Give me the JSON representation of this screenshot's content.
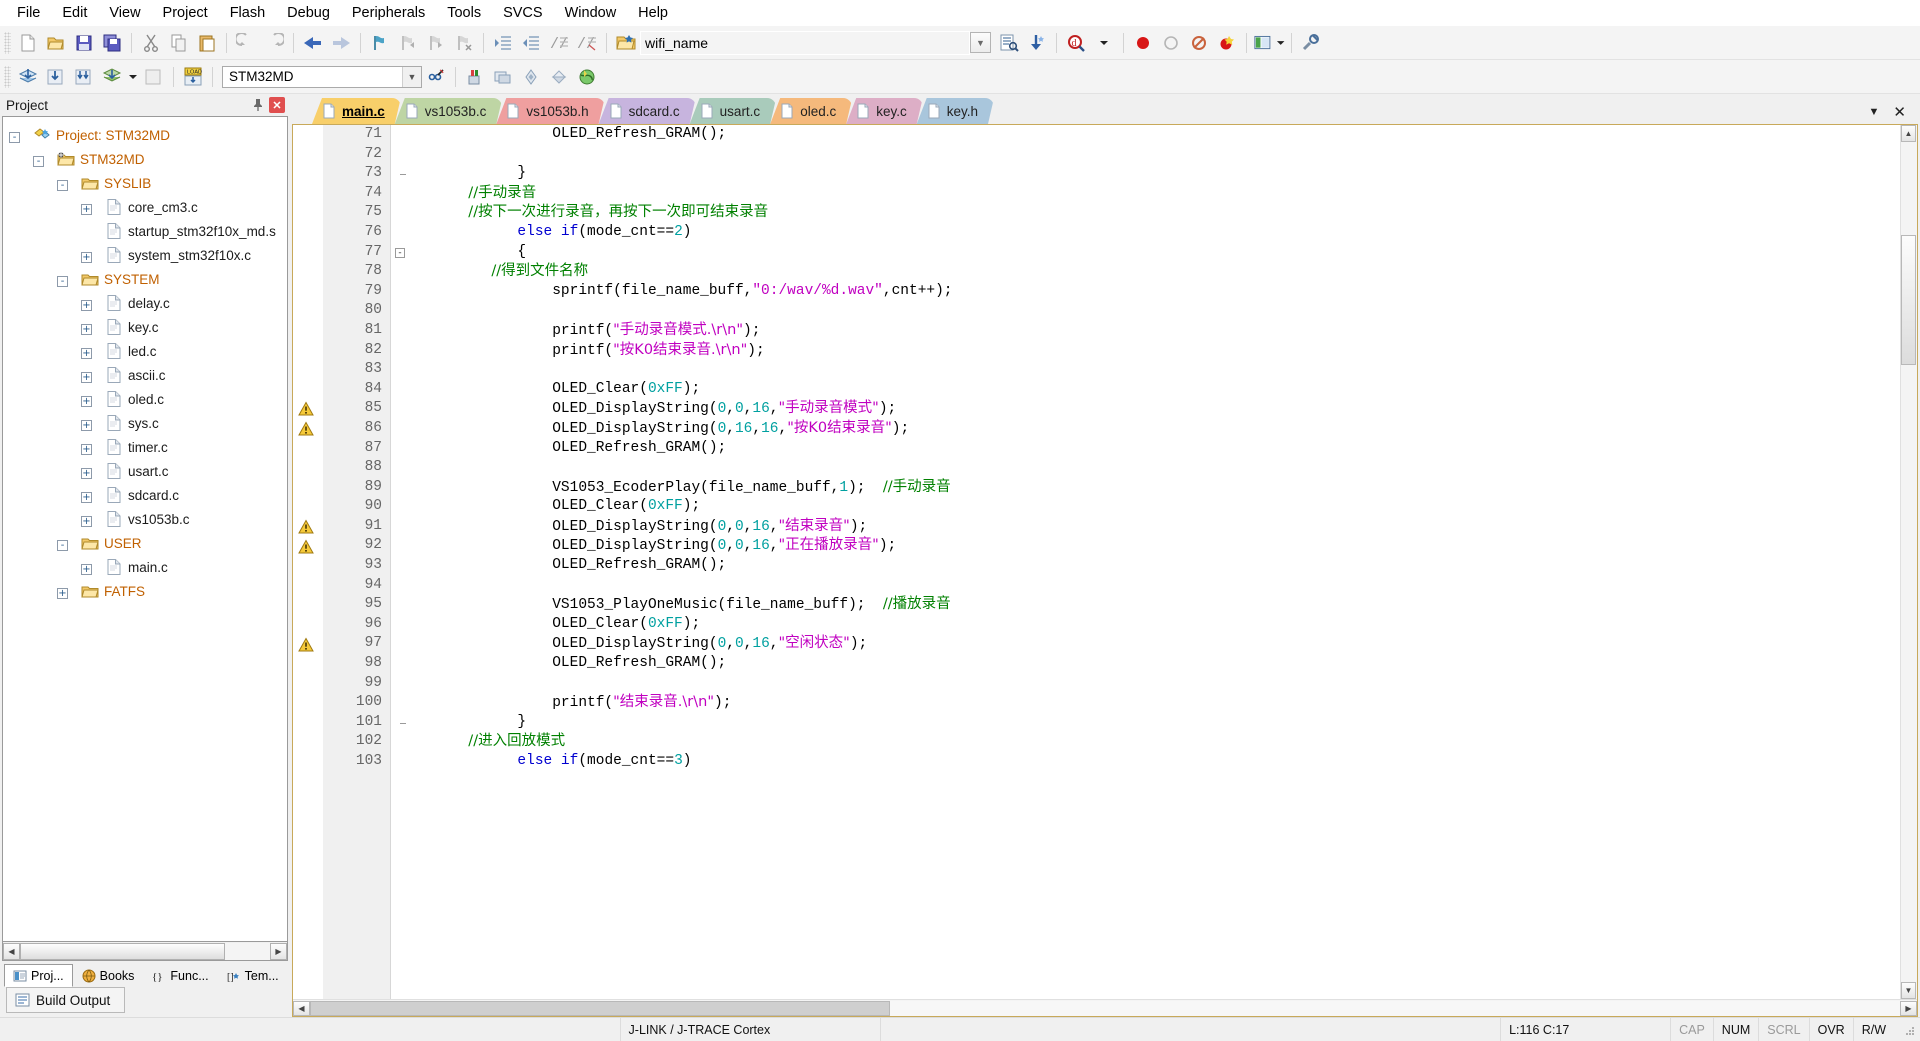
{
  "menu": {
    "items": [
      "File",
      "Edit",
      "View",
      "Project",
      "Flash",
      "Debug",
      "Peripherals",
      "Tools",
      "SVCS",
      "Window",
      "Help"
    ]
  },
  "toolbar1": {
    "icons": [
      "new-file-icon",
      "open-file-icon",
      "save-icon",
      "save-all-icon",
      "cut-icon",
      "copy-icon",
      "paste-icon",
      "undo-icon",
      "redo-icon",
      "navigate-back-icon",
      "navigate-forward-icon",
      "bookmark-toggle-icon",
      "bookmark-prev-icon",
      "bookmark-next-icon",
      "bookmark-clear-icon",
      "indent-icon",
      "outdent-icon",
      "comment-icon",
      "uncomment-icon"
    ],
    "bookmark_field": "wifi_name",
    "bookmark_placeholder": "",
    "right_icons": [
      "find-in-files-icon",
      "incremental-find-icon",
      "magnifier-icon",
      "dropdown-arrow-icon",
      "start-debug-icon",
      "insert-breakpoint-icon",
      "kill-breakpoints-icon",
      "disable-breakpoints-icon",
      "window-layout-icon",
      "configuration-wizard-icon"
    ]
  },
  "toolbar2": {
    "target": "STM32MD",
    "icons": [
      "translate-icon",
      "build-icon",
      "rebuild-icon",
      "batch-build-icon",
      "stop-build-icon",
      "download-icon",
      "target-options-icon",
      "manage-project-items-icon",
      "start-stop-debug-icon",
      "multi-project-icon",
      "books-icon",
      "functions-icon",
      "templates-icon"
    ]
  },
  "project_panel": {
    "title": "Project",
    "pin_icon": "pin-icon",
    "close_icon": "close-icon",
    "tree": [
      {
        "depth": 0,
        "label": "Project: STM32MD",
        "expander": "-",
        "icon": "project-icon",
        "kind": "root"
      },
      {
        "depth": 1,
        "label": "STM32MD",
        "expander": "-",
        "icon": "target-folder-icon",
        "kind": "folder"
      },
      {
        "depth": 2,
        "label": "SYSLIB",
        "expander": "-",
        "icon": "group-folder-icon",
        "kind": "folder"
      },
      {
        "depth": 3,
        "label": "core_cm3.c",
        "expander": "+",
        "icon": "c-file-icon",
        "kind": "file"
      },
      {
        "depth": 3,
        "label": "startup_stm32f10x_md.s",
        "expander": "",
        "icon": "asm-file-icon",
        "kind": "file"
      },
      {
        "depth": 3,
        "label": "system_stm32f10x.c",
        "expander": "+",
        "icon": "c-file-icon",
        "kind": "file"
      },
      {
        "depth": 2,
        "label": "SYSTEM",
        "expander": "-",
        "icon": "group-folder-icon",
        "kind": "folder"
      },
      {
        "depth": 3,
        "label": "delay.c",
        "expander": "+",
        "icon": "c-file-icon",
        "kind": "file"
      },
      {
        "depth": 3,
        "label": "key.c",
        "expander": "+",
        "icon": "c-file-icon",
        "kind": "file"
      },
      {
        "depth": 3,
        "label": "led.c",
        "expander": "+",
        "icon": "c-file-icon",
        "kind": "file"
      },
      {
        "depth": 3,
        "label": "ascii.c",
        "expander": "+",
        "icon": "c-file-icon",
        "kind": "file"
      },
      {
        "depth": 3,
        "label": "oled.c",
        "expander": "+",
        "icon": "c-file-icon",
        "kind": "file"
      },
      {
        "depth": 3,
        "label": "sys.c",
        "expander": "+",
        "icon": "c-file-icon",
        "kind": "file"
      },
      {
        "depth": 3,
        "label": "timer.c",
        "expander": "+",
        "icon": "c-file-icon",
        "kind": "file"
      },
      {
        "depth": 3,
        "label": "usart.c",
        "expander": "+",
        "icon": "c-file-icon",
        "kind": "file"
      },
      {
        "depth": 3,
        "label": "sdcard.c",
        "expander": "+",
        "icon": "c-file-icon",
        "kind": "file"
      },
      {
        "depth": 3,
        "label": "vs1053b.c",
        "expander": "+",
        "icon": "c-file-icon",
        "kind": "file"
      },
      {
        "depth": 2,
        "label": "USER",
        "expander": "-",
        "icon": "group-folder-icon",
        "kind": "folder"
      },
      {
        "depth": 3,
        "label": "main.c",
        "expander": "+",
        "icon": "c-file-icon",
        "kind": "file"
      },
      {
        "depth": 2,
        "label": "FATFS",
        "expander": "+",
        "icon": "group-folder-icon",
        "kind": "folder"
      }
    ],
    "bottom_tabs": [
      {
        "label": "Proj...",
        "icon": "project-tab-icon",
        "active": true
      },
      {
        "label": "Books",
        "icon": "books-tab-icon",
        "active": false
      },
      {
        "label": "Func...",
        "icon": "functions-tab-icon",
        "active": false
      },
      {
        "label": "Tem...",
        "icon": "templates-tab-icon",
        "active": false
      }
    ],
    "build_output_label": "Build Output",
    "build_output_icon": "build-output-icon"
  },
  "editor": {
    "tabs": [
      {
        "label": "main.c",
        "color": "#f8cf6a",
        "active": true
      },
      {
        "label": "vs1053b.c",
        "color": "#bed5a4",
        "active": false
      },
      {
        "label": "vs1053b.h",
        "color": "#ef9f9f",
        "active": false
      },
      {
        "label": "sdcard.c",
        "color": "#c7b4de",
        "active": false
      },
      {
        "label": "usart.c",
        "color": "#a9cbbb",
        "active": false
      },
      {
        "label": "oled.c",
        "color": "#f5b97c",
        "active": false
      },
      {
        "label": "key.c",
        "color": "#ddaec6",
        "active": false
      },
      {
        "label": "key.h",
        "color": "#a9c6dc",
        "active": false
      }
    ],
    "tabbar_caret_icon": "chevron-down-icon",
    "tabbar_close_icon": "close-icon",
    "first_line": 71,
    "lines": [
      {
        "n": 71,
        "warn": false,
        "fold": "",
        "tokens": [
          {
            "t": "                ",
            "c": "plain"
          },
          {
            "t": "OLED_Refresh_GRAM();",
            "c": "plain"
          }
        ]
      },
      {
        "n": 72,
        "warn": false,
        "fold": "",
        "tokens": []
      },
      {
        "n": 73,
        "warn": false,
        "fold": "tick",
        "tokens": [
          {
            "t": "            }",
            "c": "plain"
          }
        ]
      },
      {
        "n": 74,
        "warn": false,
        "fold": "",
        "tokens": [
          {
            "t": "            //手动录音",
            "c": "cmt"
          }
        ]
      },
      {
        "n": 75,
        "warn": false,
        "fold": "",
        "tokens": [
          {
            "t": "            //按下一次进行录音，再按下一次即可结束录音",
            "c": "cmt"
          }
        ]
      },
      {
        "n": 76,
        "warn": false,
        "fold": "",
        "tokens": [
          {
            "t": "            ",
            "c": "plain"
          },
          {
            "t": "else if",
            "c": "kw"
          },
          {
            "t": "(mode_cnt==",
            "c": "plain"
          },
          {
            "t": "2",
            "c": "num"
          },
          {
            "t": ")",
            "c": "plain"
          }
        ]
      },
      {
        "n": 77,
        "warn": false,
        "fold": "box",
        "tokens": [
          {
            "t": "            {",
            "c": "plain"
          }
        ]
      },
      {
        "n": 78,
        "warn": false,
        "fold": "",
        "tokens": [
          {
            "t": "                 //得到文件名称",
            "c": "cmt"
          }
        ]
      },
      {
        "n": 79,
        "warn": false,
        "fold": "",
        "tokens": [
          {
            "t": "                sprintf(file_name_buff,",
            "c": "plain"
          },
          {
            "t": "\"0:/wav/%d.wav\"",
            "c": "str"
          },
          {
            "t": ",cnt++);",
            "c": "plain"
          }
        ]
      },
      {
        "n": 80,
        "warn": false,
        "fold": "",
        "tokens": []
      },
      {
        "n": 81,
        "warn": false,
        "fold": "",
        "tokens": [
          {
            "t": "                printf(",
            "c": "plain"
          },
          {
            "t": "\"手动录音模式.\\r\\n\"",
            "c": "str"
          },
          {
            "t": ");",
            "c": "plain"
          }
        ]
      },
      {
        "n": 82,
        "warn": false,
        "fold": "",
        "tokens": [
          {
            "t": "                printf(",
            "c": "plain"
          },
          {
            "t": "\"按K0结束录音.\\r\\n\"",
            "c": "str"
          },
          {
            "t": ");",
            "c": "plain"
          }
        ]
      },
      {
        "n": 83,
        "warn": false,
        "fold": "",
        "tokens": []
      },
      {
        "n": 84,
        "warn": false,
        "fold": "",
        "tokens": [
          {
            "t": "                OLED_Clear(",
            "c": "plain"
          },
          {
            "t": "0xFF",
            "c": "num"
          },
          {
            "t": ");",
            "c": "plain"
          }
        ]
      },
      {
        "n": 85,
        "warn": true,
        "fold": "",
        "tokens": [
          {
            "t": "                OLED_DisplayString(",
            "c": "plain"
          },
          {
            "t": "0",
            "c": "num"
          },
          {
            "t": ",",
            "c": "plain"
          },
          {
            "t": "0",
            "c": "num"
          },
          {
            "t": ",",
            "c": "plain"
          },
          {
            "t": "16",
            "c": "num"
          },
          {
            "t": ",",
            "c": "plain"
          },
          {
            "t": "\"手动录音模式\"",
            "c": "str"
          },
          {
            "t": ");",
            "c": "plain"
          }
        ]
      },
      {
        "n": 86,
        "warn": true,
        "fold": "",
        "tokens": [
          {
            "t": "                OLED_DisplayString(",
            "c": "plain"
          },
          {
            "t": "0",
            "c": "num"
          },
          {
            "t": ",",
            "c": "plain"
          },
          {
            "t": "16",
            "c": "num"
          },
          {
            "t": ",",
            "c": "plain"
          },
          {
            "t": "16",
            "c": "num"
          },
          {
            "t": ",",
            "c": "plain"
          },
          {
            "t": "\"按K0结束录音\"",
            "c": "str"
          },
          {
            "t": ");",
            "c": "plain"
          }
        ]
      },
      {
        "n": 87,
        "warn": false,
        "fold": "",
        "tokens": [
          {
            "t": "                OLED_Refresh_GRAM();",
            "c": "plain"
          }
        ]
      },
      {
        "n": 88,
        "warn": false,
        "fold": "",
        "tokens": []
      },
      {
        "n": 89,
        "warn": false,
        "fold": "",
        "tokens": [
          {
            "t": "                VS1053_EcoderPlay(file_name_buff,",
            "c": "plain"
          },
          {
            "t": "1",
            "c": "num"
          },
          {
            "t": ");  ",
            "c": "plain"
          },
          {
            "t": "//手动录音",
            "c": "cmt"
          }
        ]
      },
      {
        "n": 90,
        "warn": false,
        "fold": "",
        "tokens": [
          {
            "t": "                OLED_Clear(",
            "c": "plain"
          },
          {
            "t": "0xFF",
            "c": "num"
          },
          {
            "t": ");",
            "c": "plain"
          }
        ]
      },
      {
        "n": 91,
        "warn": true,
        "fold": "",
        "tokens": [
          {
            "t": "                OLED_DisplayString(",
            "c": "plain"
          },
          {
            "t": "0",
            "c": "num"
          },
          {
            "t": ",",
            "c": "plain"
          },
          {
            "t": "0",
            "c": "num"
          },
          {
            "t": ",",
            "c": "plain"
          },
          {
            "t": "16",
            "c": "num"
          },
          {
            "t": ",",
            "c": "plain"
          },
          {
            "t": "\"结束录音\"",
            "c": "str"
          },
          {
            "t": ");",
            "c": "plain"
          }
        ]
      },
      {
        "n": 92,
        "warn": true,
        "fold": "",
        "tokens": [
          {
            "t": "                OLED_DisplayString(",
            "c": "plain"
          },
          {
            "t": "0",
            "c": "num"
          },
          {
            "t": ",",
            "c": "plain"
          },
          {
            "t": "0",
            "c": "num"
          },
          {
            "t": ",",
            "c": "plain"
          },
          {
            "t": "16",
            "c": "num"
          },
          {
            "t": ",",
            "c": "plain"
          },
          {
            "t": "\"正在播放录音\"",
            "c": "str"
          },
          {
            "t": ");",
            "c": "plain"
          }
        ]
      },
      {
        "n": 93,
        "warn": false,
        "fold": "",
        "tokens": [
          {
            "t": "                OLED_Refresh_GRAM();",
            "c": "plain"
          }
        ]
      },
      {
        "n": 94,
        "warn": false,
        "fold": "",
        "tokens": []
      },
      {
        "n": 95,
        "warn": false,
        "fold": "",
        "tokens": [
          {
            "t": "                VS1053_PlayOneMusic(file_name_buff);  ",
            "c": "plain"
          },
          {
            "t": "//播放录音",
            "c": "cmt"
          }
        ]
      },
      {
        "n": 96,
        "warn": false,
        "fold": "",
        "tokens": [
          {
            "t": "                OLED_Clear(",
            "c": "plain"
          },
          {
            "t": "0xFF",
            "c": "num"
          },
          {
            "t": ");",
            "c": "plain"
          }
        ]
      },
      {
        "n": 97,
        "warn": true,
        "fold": "",
        "tokens": [
          {
            "t": "                OLED_DisplayString(",
            "c": "plain"
          },
          {
            "t": "0",
            "c": "num"
          },
          {
            "t": ",",
            "c": "plain"
          },
          {
            "t": "0",
            "c": "num"
          },
          {
            "t": ",",
            "c": "plain"
          },
          {
            "t": "16",
            "c": "num"
          },
          {
            "t": ",",
            "c": "plain"
          },
          {
            "t": "\"空闲状态\"",
            "c": "str"
          },
          {
            "t": ");",
            "c": "plain"
          }
        ]
      },
      {
        "n": 98,
        "warn": false,
        "fold": "",
        "tokens": [
          {
            "t": "                OLED_Refresh_GRAM();",
            "c": "plain"
          }
        ]
      },
      {
        "n": 99,
        "warn": false,
        "fold": "",
        "tokens": []
      },
      {
        "n": 100,
        "warn": false,
        "fold": "",
        "tokens": [
          {
            "t": "                printf(",
            "c": "plain"
          },
          {
            "t": "\"结束录音.\\r\\n\"",
            "c": "str"
          },
          {
            "t": ");",
            "c": "plain"
          }
        ]
      },
      {
        "n": 101,
        "warn": false,
        "fold": "tick",
        "tokens": [
          {
            "t": "            }",
            "c": "plain"
          }
        ]
      },
      {
        "n": 102,
        "warn": false,
        "fold": "",
        "tokens": [
          {
            "t": "            //进入回放模式",
            "c": "cmt"
          }
        ]
      },
      {
        "n": 103,
        "warn": false,
        "fold": "",
        "tokens": [
          {
            "t": "            ",
            "c": "plain"
          },
          {
            "t": "else if",
            "c": "kw"
          },
          {
            "t": "(mode_cnt==",
            "c": "plain"
          },
          {
            "t": "3",
            "c": "num"
          },
          {
            "t": ")",
            "c": "plain"
          }
        ]
      }
    ]
  },
  "statusbar": {
    "debugger": "J-LINK / J-TRACE Cortex",
    "cursor": "L:116 C:17",
    "cap": "CAP",
    "num": "NUM",
    "scrl": "SCRL",
    "ovr": "OVR",
    "rw": "R/W",
    "resize_icon": "resize-grip-icon"
  }
}
